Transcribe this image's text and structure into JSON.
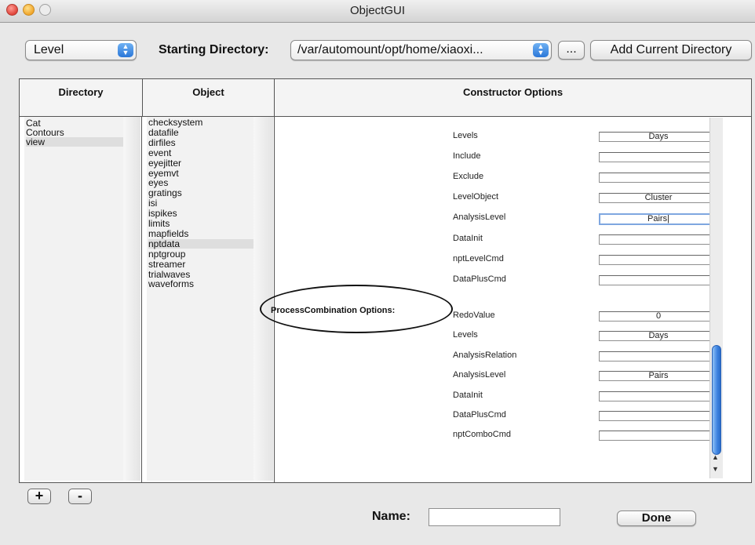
{
  "window": {
    "title": "ObjectGUI"
  },
  "toolbar": {
    "level_select": "Level",
    "starting_directory_label": "Starting Directory:",
    "directory_select": "/var/automount/opt/home/xiaoxi...",
    "browse_label": "...",
    "add_current_directory_label": "Add Current Directory"
  },
  "table": {
    "headers": {
      "directory": "Directory",
      "object": "Object",
      "options": "Constructor Options"
    }
  },
  "directories": [
    "Cat",
    "Contours",
    "view"
  ],
  "selected_directory": "view",
  "objects": [
    "checksystem",
    "datafile",
    "dirfiles",
    "event",
    "eyejitter",
    "eyemvt",
    "eyes",
    "gratings",
    "isi",
    "ispikes",
    "limits",
    "mapfields",
    "nptdata",
    "nptgroup",
    "streamer",
    "trialwaves",
    "waveforms"
  ],
  "selected_object": "nptdata",
  "constructor_options": [
    {
      "label": "Levels",
      "value": "Days"
    },
    {
      "label": "Include",
      "value": ""
    },
    {
      "label": "Exclude",
      "value": ""
    },
    {
      "label": "LevelObject",
      "value": "Cluster"
    },
    {
      "label": "AnalysisLevel",
      "value": "Pairs|"
    },
    {
      "label": "DataInit",
      "value": ""
    },
    {
      "label": "nptLevelCmd",
      "value": ""
    },
    {
      "label": "DataPlusCmd",
      "value": ""
    }
  ],
  "process_combination": {
    "heading": "ProcessCombination Options:",
    "options": [
      {
        "label": "RedoValue",
        "value": "0"
      },
      {
        "label": "Levels",
        "value": "Days"
      },
      {
        "label": "AnalysisRelation",
        "value": ""
      },
      {
        "label": "AnalysisLevel",
        "value": "Pairs"
      },
      {
        "label": "DataInit",
        "value": ""
      },
      {
        "label": "DataPlusCmd",
        "value": ""
      },
      {
        "label": "nptComboCmd",
        "value": ""
      }
    ]
  },
  "footer": {
    "add_label": "+",
    "remove_label": "-",
    "name_label": "Name:",
    "name_value": "",
    "done_label": "Done"
  },
  "colors": {
    "accent": "#2b77d8",
    "annotation": "#111111"
  }
}
